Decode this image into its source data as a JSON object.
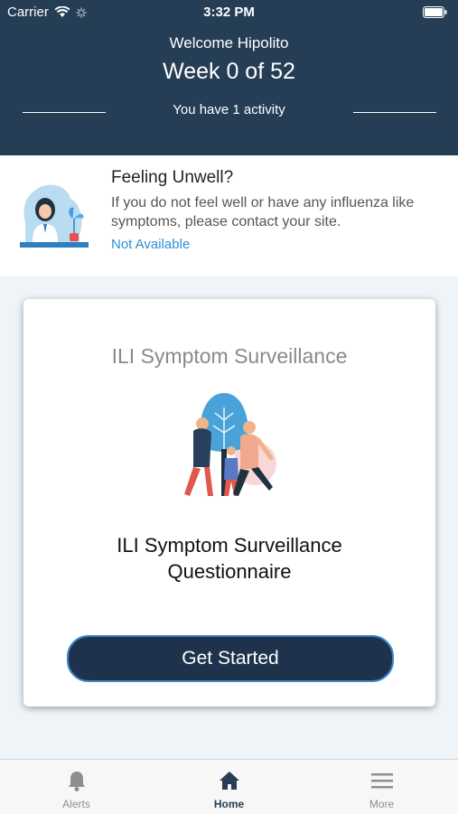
{
  "status_bar": {
    "carrier": "Carrier",
    "time": "3:32 PM"
  },
  "header": {
    "welcome": "Welcome Hipolito",
    "week": "Week 0 of 52",
    "activity": "You have 1 activity"
  },
  "unwell": {
    "title": "Feeling Unwell?",
    "description": "If you do not feel well or have any influenza like symptoms, please contact your site.",
    "link": "Not Available"
  },
  "card": {
    "title": "ILI Symptom Surveillance",
    "questionnaire_line1": "ILI Symptom Surveillance",
    "questionnaire_line2": "Questionnaire",
    "button": "Get Started"
  },
  "tabbar": {
    "tabs": [
      {
        "label": "Alerts",
        "icon": "bell-icon"
      },
      {
        "label": "Home",
        "icon": "home-icon",
        "active": true
      },
      {
        "label": "More",
        "icon": "menu-icon"
      }
    ]
  },
  "colors": {
    "header_bg": "#253d55",
    "link": "#2f8fd4",
    "button_bg": "#1e334b",
    "button_border": "#3a86c8"
  }
}
